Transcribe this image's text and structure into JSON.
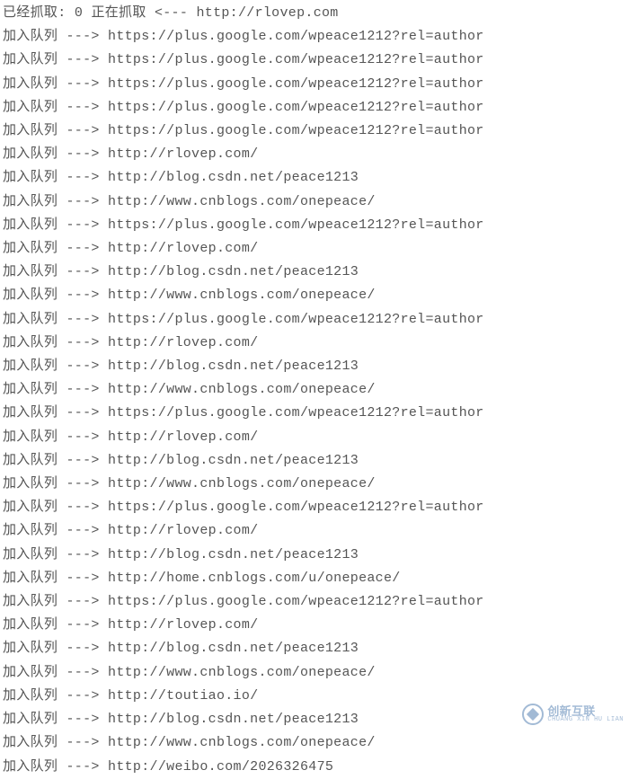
{
  "header": {
    "crawled_label": "已经抓取: ",
    "crawled_count": "0",
    "crawling_label": "正在抓取 <---",
    "crawling_url": "http://rlovep.com"
  },
  "queue_label": "加入队列 --->",
  "watermark": {
    "main": "创新互联",
    "sub": "CHUANG XIN HU LIAN"
  },
  "lines": [
    {
      "url": "https://plus.google.com/wpeace1212?rel=author"
    },
    {
      "url": "https://plus.google.com/wpeace1212?rel=author"
    },
    {
      "url": "https://plus.google.com/wpeace1212?rel=author"
    },
    {
      "url": "https://plus.google.com/wpeace1212?rel=author"
    },
    {
      "url": "https://plus.google.com/wpeace1212?rel=author"
    },
    {
      "url": "http://rlovep.com/"
    },
    {
      "url": "http://blog.csdn.net/peace1213"
    },
    {
      "url": "http://www.cnblogs.com/onepeace/"
    },
    {
      "url": "https://plus.google.com/wpeace1212?rel=author"
    },
    {
      "url": "http://rlovep.com/"
    },
    {
      "url": "http://blog.csdn.net/peace1213"
    },
    {
      "url": "http://www.cnblogs.com/onepeace/"
    },
    {
      "url": "https://plus.google.com/wpeace1212?rel=author"
    },
    {
      "url": "http://rlovep.com/"
    },
    {
      "url": "http://blog.csdn.net/peace1213"
    },
    {
      "url": "http://www.cnblogs.com/onepeace/"
    },
    {
      "url": "https://plus.google.com/wpeace1212?rel=author"
    },
    {
      "url": "http://rlovep.com/"
    },
    {
      "url": "http://blog.csdn.net/peace1213"
    },
    {
      "url": "http://www.cnblogs.com/onepeace/"
    },
    {
      "url": "https://plus.google.com/wpeace1212?rel=author"
    },
    {
      "url": "http://rlovep.com/"
    },
    {
      "url": "http://blog.csdn.net/peace1213"
    },
    {
      "url": "http://home.cnblogs.com/u/onepeace/"
    },
    {
      "url": "https://plus.google.com/wpeace1212?rel=author"
    },
    {
      "url": "http://rlovep.com/"
    },
    {
      "url": "http://blog.csdn.net/peace1213"
    },
    {
      "url": "http://www.cnblogs.com/onepeace/"
    },
    {
      "url": "http://toutiao.io/"
    },
    {
      "url": "http://blog.csdn.net/peace1213"
    },
    {
      "url": "http://www.cnblogs.com/onepeace/"
    },
    {
      "url": "http://weibo.com/2026326475"
    }
  ]
}
